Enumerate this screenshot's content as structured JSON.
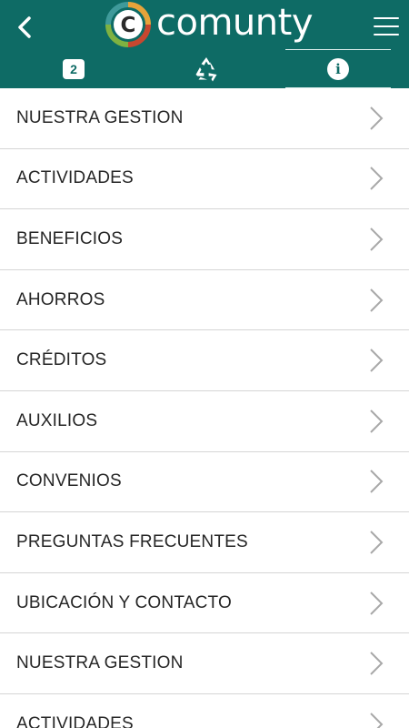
{
  "colors": {
    "brand": "#0e6b65",
    "text": "#262626",
    "divider": "#d5d5d5",
    "chevron": "#a8a8a8"
  },
  "header": {
    "back_icon": "chevron-left-icon",
    "logo_text": "comunty",
    "logo_letter": "C",
    "menu_icon": "hamburger-menu-icon"
  },
  "tabs": [
    {
      "icon": "badge-icon",
      "label": "2"
    },
    {
      "icon": "recycle-icon",
      "label": ""
    },
    {
      "icon": "info-icon",
      "label": "i",
      "active": true
    }
  ],
  "menu": {
    "items": [
      {
        "label": "NUESTRA GESTION"
      },
      {
        "label": "ACTIVIDADES"
      },
      {
        "label": "BENEFICIOS"
      },
      {
        "label": "AHORROS"
      },
      {
        "label": "CRÉDITOS"
      },
      {
        "label": "AUXILIOS"
      },
      {
        "label": "CONVENIOS"
      },
      {
        "label": "PREGUNTAS FRECUENTES"
      },
      {
        "label": "UBICACIÓN Y CONTACTO"
      },
      {
        "label": "NUESTRA GESTION"
      },
      {
        "label": "ACTIVIDADES"
      }
    ]
  }
}
